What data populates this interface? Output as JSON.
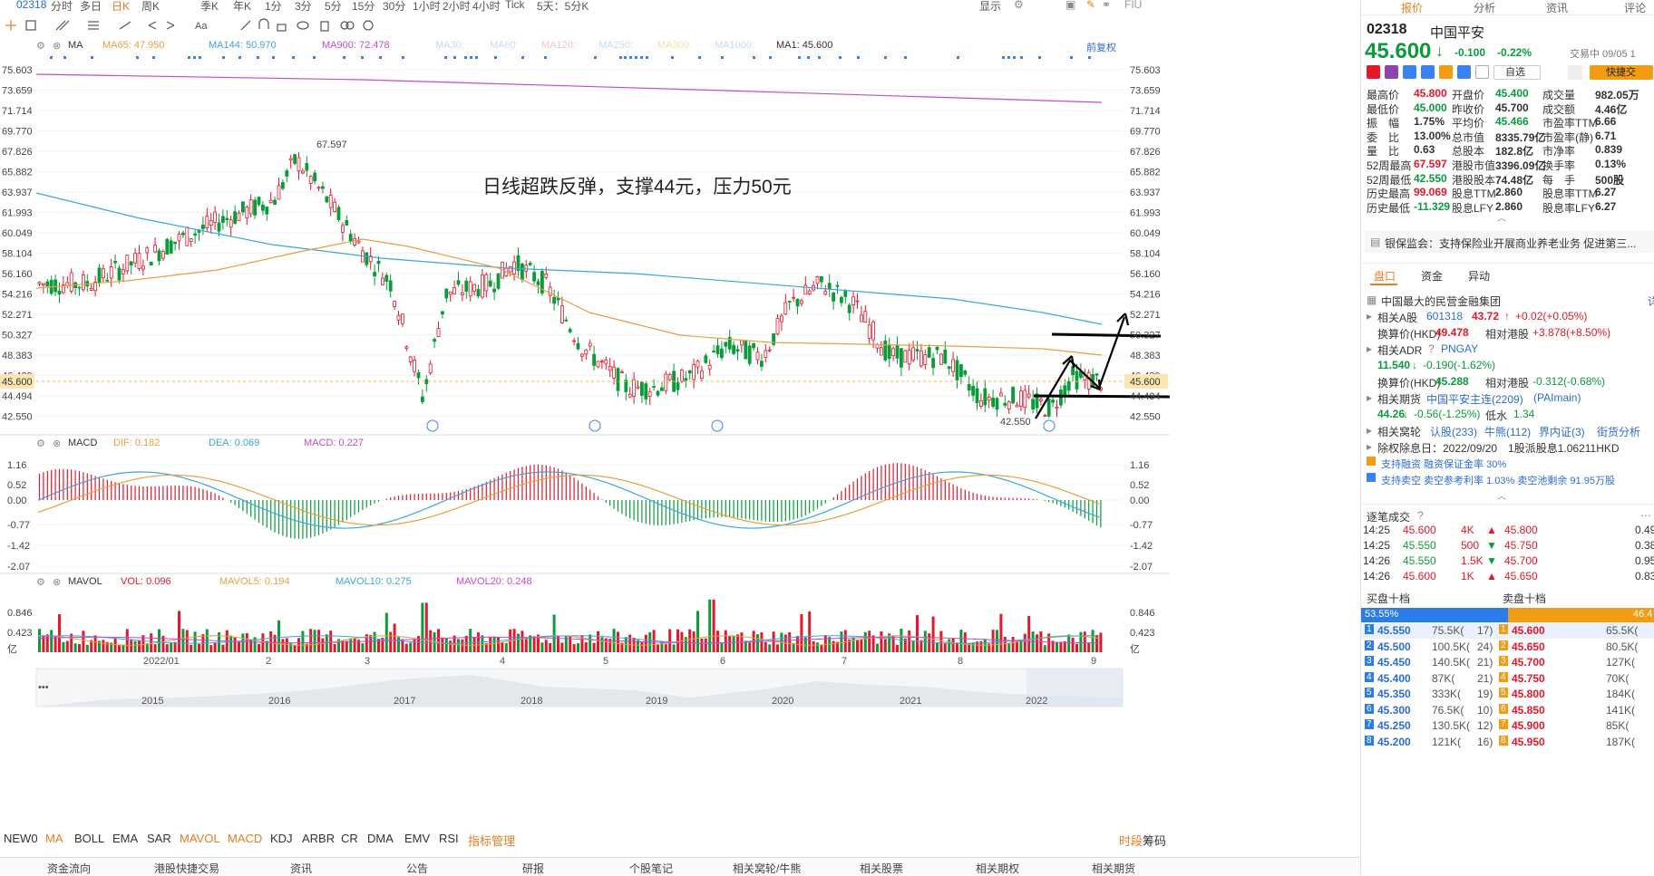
{
  "top_tabs": [
    "02318",
    "分时",
    "多日",
    "日K",
    "周K",
    "季K",
    "年K",
    "1分",
    "3分",
    "5分",
    "15分",
    "30分",
    "1小时",
    "2小时",
    "4小时",
    "Tick",
    "5天：5分K"
  ],
  "top_right": {
    "display": "显示",
    "fiu": "FIU"
  },
  "ma_bar": {
    "label": "MA",
    "ma65": "MA65: 47.950",
    "ma144": "MA144: 50.970",
    "ma900": "MA900: 72.478",
    "ma30": "MA30:",
    "ma60": "MA60:",
    "ma120": "MA120:",
    "ma250": "MA250:",
    "ma300": "MA300:",
    "ma1000": "MA1000:",
    "ma1": "MA1: 45.600",
    "adj": "前复权"
  },
  "price_axis": [
    "75.603",
    "73.659",
    "71.714",
    "69.770",
    "67.826",
    "65.882",
    "63.937",
    "61.993",
    "60.049",
    "58.104",
    "56.160",
    "54.216",
    "52.271",
    "50.327",
    "48.383",
    "46.439",
    "44.494",
    "42.550"
  ],
  "current_price_tag": "45.600",
  "annotation": "日线超跌反弹，支撑44元，压力50元",
  "high_label": "67.597",
  "low_label": "42.550",
  "macd_bar": {
    "label": "MACD",
    "dif": "DIF: 0.182",
    "dea": "DEA: 0.069",
    "macd": "MACD: 0.227"
  },
  "macd_axis": [
    "1.16",
    "0.52",
    "0.00",
    "-0.77",
    "-1.42",
    "-2.07"
  ],
  "mavol_bar": {
    "label": "MAVOL",
    "vol": "VOL: 0.096",
    "m5": "MAVOL5: 0.194",
    "m10": "MAVOL10: 0.275",
    "m20": "MAVOL20: 0.248"
  },
  "vol_axis": [
    "0.846",
    "0.423",
    "亿"
  ],
  "x_months": [
    "2022/01",
    "2",
    "3",
    "4",
    "5",
    "6",
    "7",
    "8",
    "9"
  ],
  "x_years": [
    "2015",
    "2016",
    "2017",
    "2018",
    "2019",
    "2020",
    "2021",
    "2022"
  ],
  "bottom_indicators": [
    "NEW0",
    "MA",
    "BOLL",
    "EMA",
    "SAR",
    "MAVOL",
    "MACD",
    "KDJ",
    "ARBR",
    "CR",
    "DMA",
    "EMV",
    "RSI",
    "指标管理"
  ],
  "bottom_right": [
    "时段",
    "筹码"
  ],
  "footer": [
    "资金流向",
    "港股快捷交易",
    "资讯",
    "公告",
    "研报",
    "个股笔记",
    "相关窝轮/牛熊",
    "相关股票",
    "相关期权",
    "相关期货"
  ],
  "rp": {
    "tabs": [
      "报价",
      "分析",
      "资讯",
      "评论"
    ],
    "code": "02318",
    "name": "中国平安",
    "price": "45.600",
    "arrow": "↓",
    "change": "-0.100",
    "pct": "-0.22%",
    "trading": "交易中 09/05 1",
    "watch": "自选",
    "quick": "快捷交",
    "quote_cols": [
      [
        [
          "最高价",
          "45.800",
          "red"
        ],
        [
          "最低价",
          "45.000",
          "green"
        ],
        [
          "振　幅",
          "1.75%",
          ""
        ],
        [
          "委　比",
          "13.00%",
          ""
        ],
        [
          "量　比",
          "0.63",
          ""
        ],
        [
          "52周最高",
          "67.597",
          "red"
        ],
        [
          "52周最低",
          "42.550",
          "green"
        ],
        [
          "历史最高",
          "99.069",
          "red"
        ],
        [
          "历史最低",
          "-11.329",
          "green"
        ]
      ],
      [
        [
          "开盘价",
          "45.400",
          "green"
        ],
        [
          "昨收价",
          "45.700",
          ""
        ],
        [
          "平均价",
          "45.466",
          "green"
        ],
        [
          "总市值",
          "8335.79亿",
          ""
        ],
        [
          "总股本",
          "182.8亿",
          ""
        ],
        [
          "港股市值",
          "3396.09亿",
          ""
        ],
        [
          "港股股本",
          "74.48亿",
          ""
        ],
        [
          "股息TTM",
          "2.860",
          ""
        ],
        [
          "股息LFY",
          "2.860",
          ""
        ]
      ],
      [
        [
          "成交量",
          "982.05万",
          ""
        ],
        [
          "成交额",
          "4.46亿",
          ""
        ],
        [
          "市盈率TTM",
          "6.66",
          ""
        ],
        [
          "市盈率(静)",
          "6.71",
          ""
        ],
        [
          "市净率",
          "0.839",
          ""
        ],
        [
          "换手率",
          "0.13%",
          ""
        ],
        [
          "每　手",
          "500股",
          ""
        ],
        [
          "股息率TTM",
          "6.27",
          ""
        ],
        [
          "股息率LFY",
          "6.27",
          ""
        ]
      ]
    ],
    "news": "银保监会：支持保险业开展商业养老业务 促进第三...",
    "sub_tabs": [
      "盘口",
      "资金",
      "异动"
    ],
    "company": "中国最大的民营金融集团",
    "a_share": {
      "label": "相关A股",
      "code": "601318",
      "price": "43.72",
      "arrow": "↑",
      "chg": "+0.02(+0.05%)"
    },
    "a_conv": {
      "label": "换算价(HKD)",
      "val": "49.478",
      "rel_label": "相对港股",
      "rel": "+3.878(+8.50%)"
    },
    "adr": {
      "label": "相关ADR",
      "code": "PNGAY",
      "price": "11.540",
      "arrow": "↓",
      "chg": "-0.190(-1.62%)"
    },
    "adr_conv": {
      "label": "换算价(HKD)",
      "val": "45.288",
      "rel_label": "相对港股",
      "rel": "-0.312(-0.68%)"
    },
    "futures": {
      "label": "相关期货",
      "name": "中国平安主连(2209)",
      "code": "(PAImain)",
      "price": "44.26",
      "arrow": "↓",
      "chg": "-0.56(-1.25%)",
      "basis_label": "低水",
      "basis": "1.34"
    },
    "warrants": {
      "label": "相关窝轮",
      "a": "认股(233)",
      "b": "牛熊(112)",
      "c": "界内证(3)",
      "d": "街货分析"
    },
    "exdiv": "除权除息日：2022/09/20　1股派股息1.06211HKD",
    "margin": "支持融资 融资保证金率 30%",
    "short": "支持卖空 卖空参考利率 1.03% 卖空池剩余 91.95万股",
    "ticks_title": "逐笔成交",
    "ticks": [
      [
        "14:25",
        "45.600",
        "4K",
        "▲"
      ],
      [
        "14:25",
        "45.550",
        "500",
        "▼"
      ],
      [
        "14:26",
        "45.550",
        "1.5K",
        "▼"
      ],
      [
        "14:26",
        "45.600",
        "1K",
        "▲"
      ]
    ],
    "ticks_right": [
      [
        "45.800",
        "0.49"
      ],
      [
        "45.750",
        "0.38"
      ],
      [
        "45.700",
        "0.95"
      ],
      [
        "45.650",
        "0.83"
      ]
    ],
    "bid_title": "买盘十档",
    "ask_title": "卖盘十档",
    "bid_pct": "53.55%",
    "ask_pct": "46.4",
    "book": [
      [
        "1",
        "45.550",
        "75.5K(",
        "17)",
        "1",
        "45.600",
        "65.5K("
      ],
      [
        "2",
        "45.500",
        "100.5K(",
        "24)",
        "2",
        "45.650",
        "80.5K("
      ],
      [
        "3",
        "45.450",
        "140.5K(",
        "21)",
        "3",
        "45.700",
        "127K("
      ],
      [
        "4",
        "45.400",
        "87K(",
        "21)",
        "4",
        "45.750",
        "70K("
      ],
      [
        "5",
        "45.350",
        "333K(",
        "19)",
        "5",
        "45.800",
        "184K("
      ],
      [
        "6",
        "45.300",
        "76.5K(",
        "10)",
        "6",
        "45.850",
        "141K("
      ],
      [
        "7",
        "45.250",
        "130.5K(",
        "12)",
        "7",
        "45.900",
        "85K("
      ],
      [
        "8",
        "45.200",
        "121K(",
        "16)",
        "8",
        "45.950",
        "187K("
      ]
    ]
  }
}
